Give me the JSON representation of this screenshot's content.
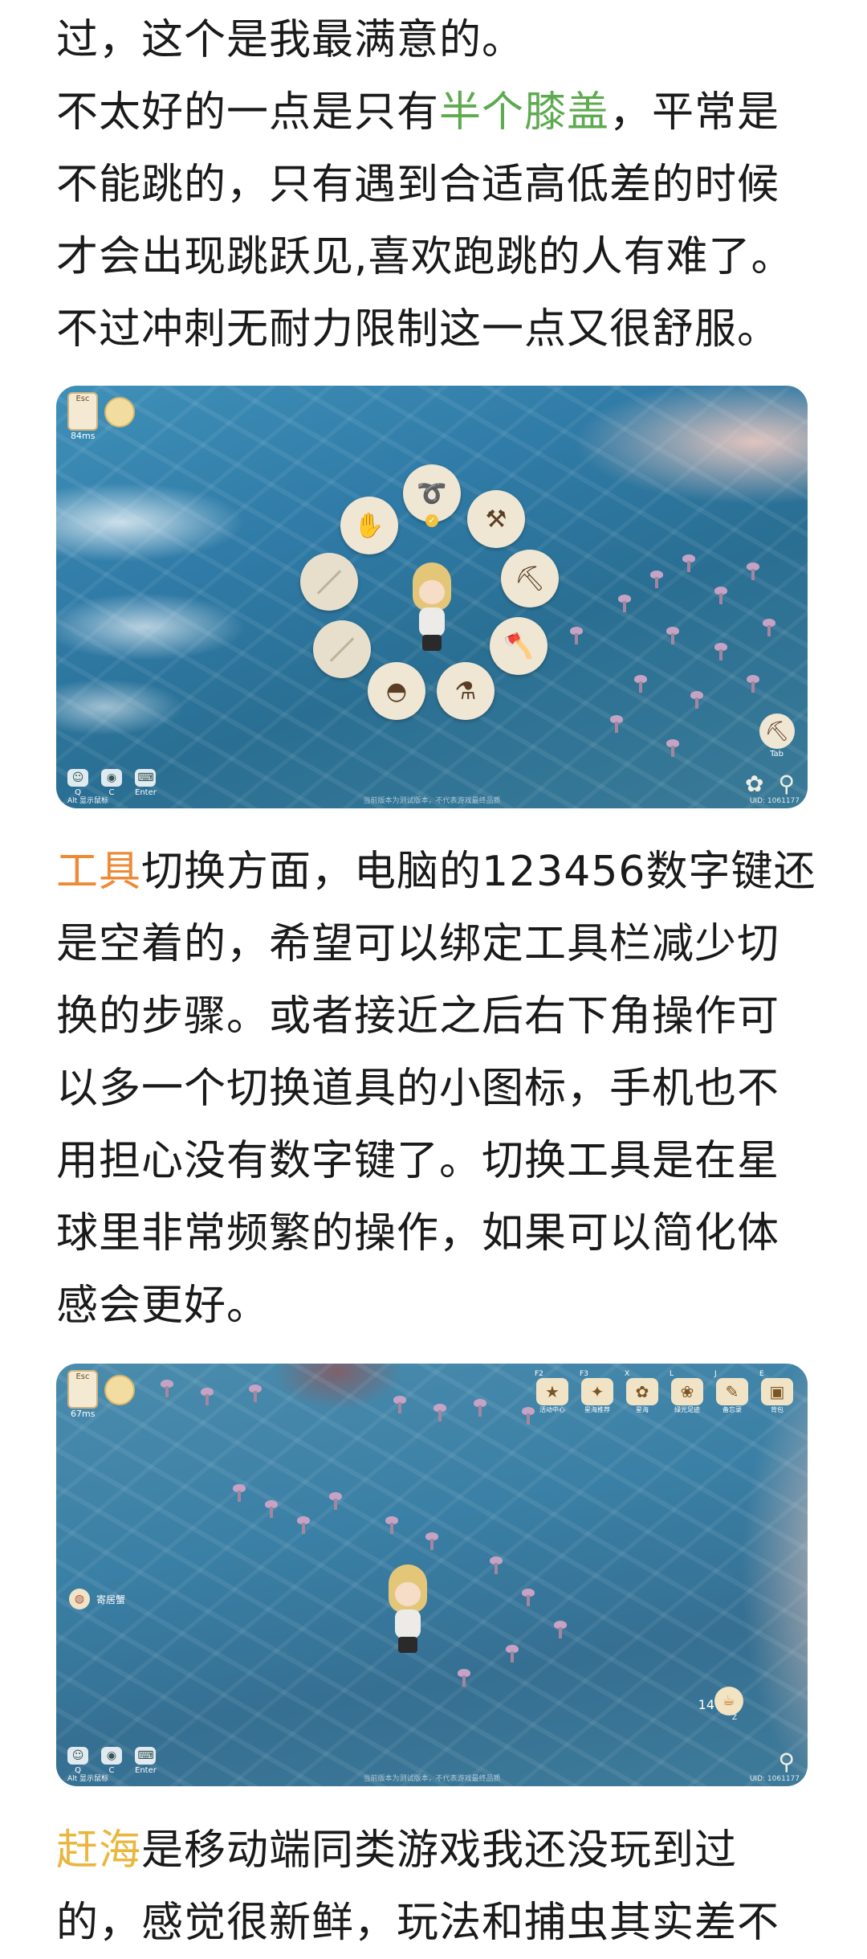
{
  "paragraphs": {
    "p1": {
      "text": "过，这个是我最满意的。"
    },
    "p2": {
      "before": "不太好的一点是只有",
      "highlight": "半个膝盖",
      "after": "，平常是不能跳的，只有遇到合适高低差的时候才会出现跳跃见,喜欢跑跳的人有难了。不过冲刺无耐力限制这一点又很舒服。"
    },
    "p3": {
      "highlight": "工具",
      "after": "切换方面，电脑的123456数字键还是空着的，希望可以绑定工具栏减少切换的步骤。或者接近之后右下角操作可以多一个切换道具的小图标，手机也不用担心没有数字键了。切换工具是在星球里非常频繁的操作，如果可以简化体感会更好。"
    },
    "p4": {
      "highlight": "赶海",
      "after": "是移动端同类游戏我还没玩到过的，感觉很新鲜，玩法和捕虫其实差不"
    }
  },
  "colors": {
    "green_highlight": "#5daa4f",
    "orange_highlight": "#ee8a35",
    "gold_highlight": "#e9b73f"
  },
  "screenshot1": {
    "hud": {
      "esc_key": "Esc",
      "ping": "84ms"
    },
    "tool_wheel": [
      {
        "name": "hand-icon",
        "glyph": "✋"
      },
      {
        "name": "fishing-rod-icon",
        "glyph": "➰"
      },
      {
        "name": "net-icon",
        "glyph": "⚒"
      },
      {
        "name": "shovel-icon",
        "glyph": "⛏"
      },
      {
        "name": "axe-icon",
        "glyph": "🪓"
      },
      {
        "name": "pot-icon",
        "glyph": "⚗"
      },
      {
        "name": "pan-icon",
        "glyph": "◓"
      }
    ],
    "bottom_keys": [
      {
        "name": "emote-key",
        "glyph": "☺",
        "key": "Q"
      },
      {
        "name": "camera-key",
        "glyph": "◉",
        "key": "C"
      },
      {
        "name": "chat-key",
        "glyph": "⌨",
        "key": "Enter"
      }
    ],
    "alt_hint": "Alt 显示鼠标",
    "tab_key": "Tab",
    "uid": "UID: 1061177",
    "notice": "当前版本为测试版本，不代表游戏最终品质"
  },
  "screenshot2": {
    "hud": {
      "esc_key": "Esc",
      "ping": "67ms"
    },
    "top_menu": [
      {
        "key": "F2",
        "label": "活动中心",
        "glyph": "★"
      },
      {
        "key": "F3",
        "label": "星海推荐",
        "glyph": "✦"
      },
      {
        "key": "X",
        "label": "星海",
        "glyph": "✿"
      },
      {
        "key": "L",
        "label": "绿光足迹",
        "glyph": "❀"
      },
      {
        "key": "J",
        "label": "备忘录",
        "glyph": "✎"
      },
      {
        "key": "E",
        "label": "背包",
        "glyph": "▣"
      }
    ],
    "npc_label": "寄居蟹",
    "item_count": "14",
    "item_key": "Z",
    "bottom_keys": [
      {
        "name": "emote-key",
        "glyph": "☺",
        "key": "Q"
      },
      {
        "name": "camera-key",
        "glyph": "◉",
        "key": "C"
      },
      {
        "name": "chat-key",
        "glyph": "⌨",
        "key": "Enter"
      }
    ],
    "alt_hint": "Alt 显示鼠标",
    "uid": "UID: 1061177",
    "notice": "当前版本为测试版本，不代表游戏最终品质"
  }
}
